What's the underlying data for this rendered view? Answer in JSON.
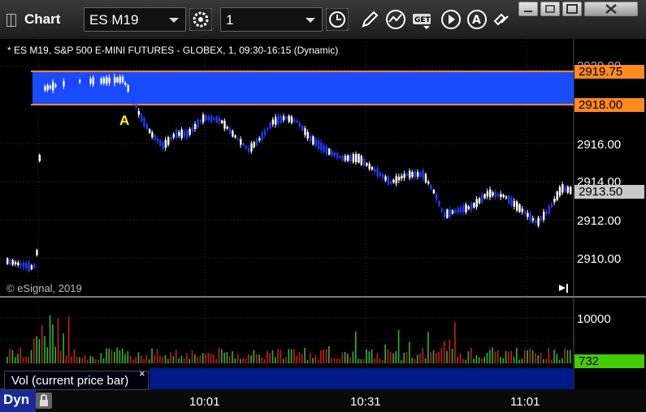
{
  "titlebar": {
    "app_title": "Chart",
    "symbol_value": "ES M19",
    "interval_value": "1"
  },
  "icons": {
    "app": "chart-window-icon",
    "settings": "gear-icon",
    "clock": "clock-icon",
    "draw": "pencil-icon",
    "studies": "study-curve-icon",
    "get": "get-data-icon",
    "play": "play-icon",
    "alert": "alert-icon",
    "link": "link-icon",
    "minimize": "minimize-icon",
    "restore": "restore-icon",
    "maximize": "maximize-icon",
    "close": "close-icon",
    "scroll_end": "scroll-to-end-icon",
    "lock": "lock-icon"
  },
  "chart": {
    "header": "* ES M19, S&P 500 E-MINI FUTURES - GLOBEX, 1, 09:30-16:15 (Dynamic)",
    "copyright": "© eSignal, 2019",
    "annotation": "A",
    "price_labels": [
      "2920.00",
      "2916.00",
      "2914.00",
      "2912.00",
      "2910.00"
    ],
    "highlight_top_label": "2919.75",
    "highlight_bottom_label": "2918.00",
    "last_price_label": "2913.50",
    "time_labels": [
      "10:01",
      "10:31",
      "11:01"
    ],
    "colors": {
      "highlight": "#1a4cff",
      "up": "#ffffff",
      "down": "#1f3dff",
      "vol_up": "#2db52d",
      "vol_down": "#c41e1e",
      "orange": "#ff8a1f",
      "last_vol": "#44cc00"
    }
  },
  "volume": {
    "label": "Vol (current price bar)",
    "close_symbol": "×",
    "axis_label": "10000",
    "last_value": "732"
  },
  "footer": {
    "mode": "Dyn"
  }
}
